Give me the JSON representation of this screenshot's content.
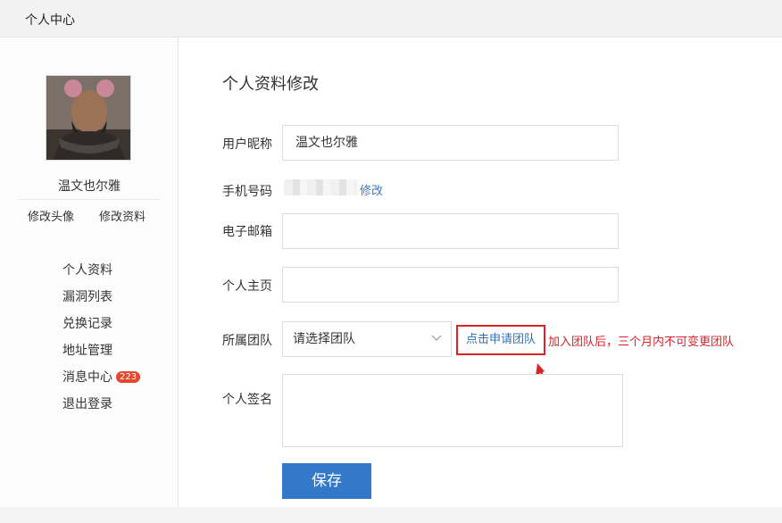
{
  "header": {
    "title": "个人中心"
  },
  "sidebar": {
    "username": "温文也尔雅",
    "profile_actions": {
      "edit_avatar": "修改头像",
      "edit_profile": "修改资料"
    },
    "menu": [
      {
        "label": "个人资料"
      },
      {
        "label": "漏洞列表"
      },
      {
        "label": "兑换记录"
      },
      {
        "label": "地址管理"
      },
      {
        "label": "消息中心",
        "badge": "223"
      },
      {
        "label": "退出登录"
      }
    ]
  },
  "form": {
    "heading": "个人资料修改",
    "nickname": {
      "label": "用户昵称",
      "value": "温文也尔雅"
    },
    "phone": {
      "label": "手机号码",
      "edit_link": "修改"
    },
    "email": {
      "label": "电子邮箱",
      "value": ""
    },
    "homepage": {
      "label": "个人主页",
      "value": ""
    },
    "team": {
      "label": "所属团队",
      "select_value": "请选择团队",
      "apply_button": "点击申请团队",
      "notice": "加入团队后，三个月内不可变更团队"
    },
    "signature": {
      "label": "个人签名",
      "value": ""
    },
    "save_button": "保存"
  },
  "colors": {
    "accent": "#3478c9",
    "link": "#2e6fb9",
    "highlight": "#d8232a",
    "badge": "#e0492f"
  },
  "icons": {
    "select": "chevron-down-icon",
    "annotation": "arrow-up-icon"
  }
}
